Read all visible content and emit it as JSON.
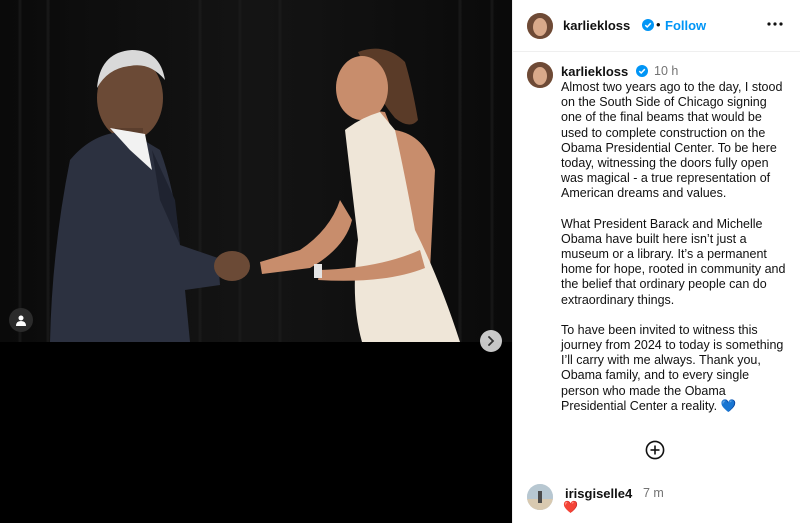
{
  "header": {
    "username": "karliekloss",
    "dot": "•",
    "follow_label": "Follow"
  },
  "caption": {
    "username": "karliekloss",
    "time": "10 h",
    "paragraphs": [
      "Almost two years ago to the day, I stood on the South Side of Chicago signing one of the final beams that would be used to complete construction on the Obama Presidential Center. To be here today, witnessing the doors fully open was magical - a true representation of American dreams and values.",
      "What President Barack and Michelle Obama have built here isn’t just a museum or a library. It’s a permanent home for hope, rooted in community and the belief that ordinary people can do extraordinary things.",
      "To have been invited to witness this journey from 2024 to today is something I’ll carry with me always. Thank you, Obama family, and to every single person who made the Obama Presidential Center a reality. 💙"
    ]
  },
  "comment": {
    "username": "irisgiselle4",
    "time": "7 m",
    "text": "❤️"
  },
  "colors": {
    "accent": "#0095f6",
    "verified": "#0095f6",
    "photo_background": "#0b0b0b"
  },
  "icons": [
    "verified-badge-icon",
    "more-options-icon",
    "user-tag-icon",
    "chevron-right-icon",
    "add-circle-icon",
    "heart-emoji"
  ]
}
